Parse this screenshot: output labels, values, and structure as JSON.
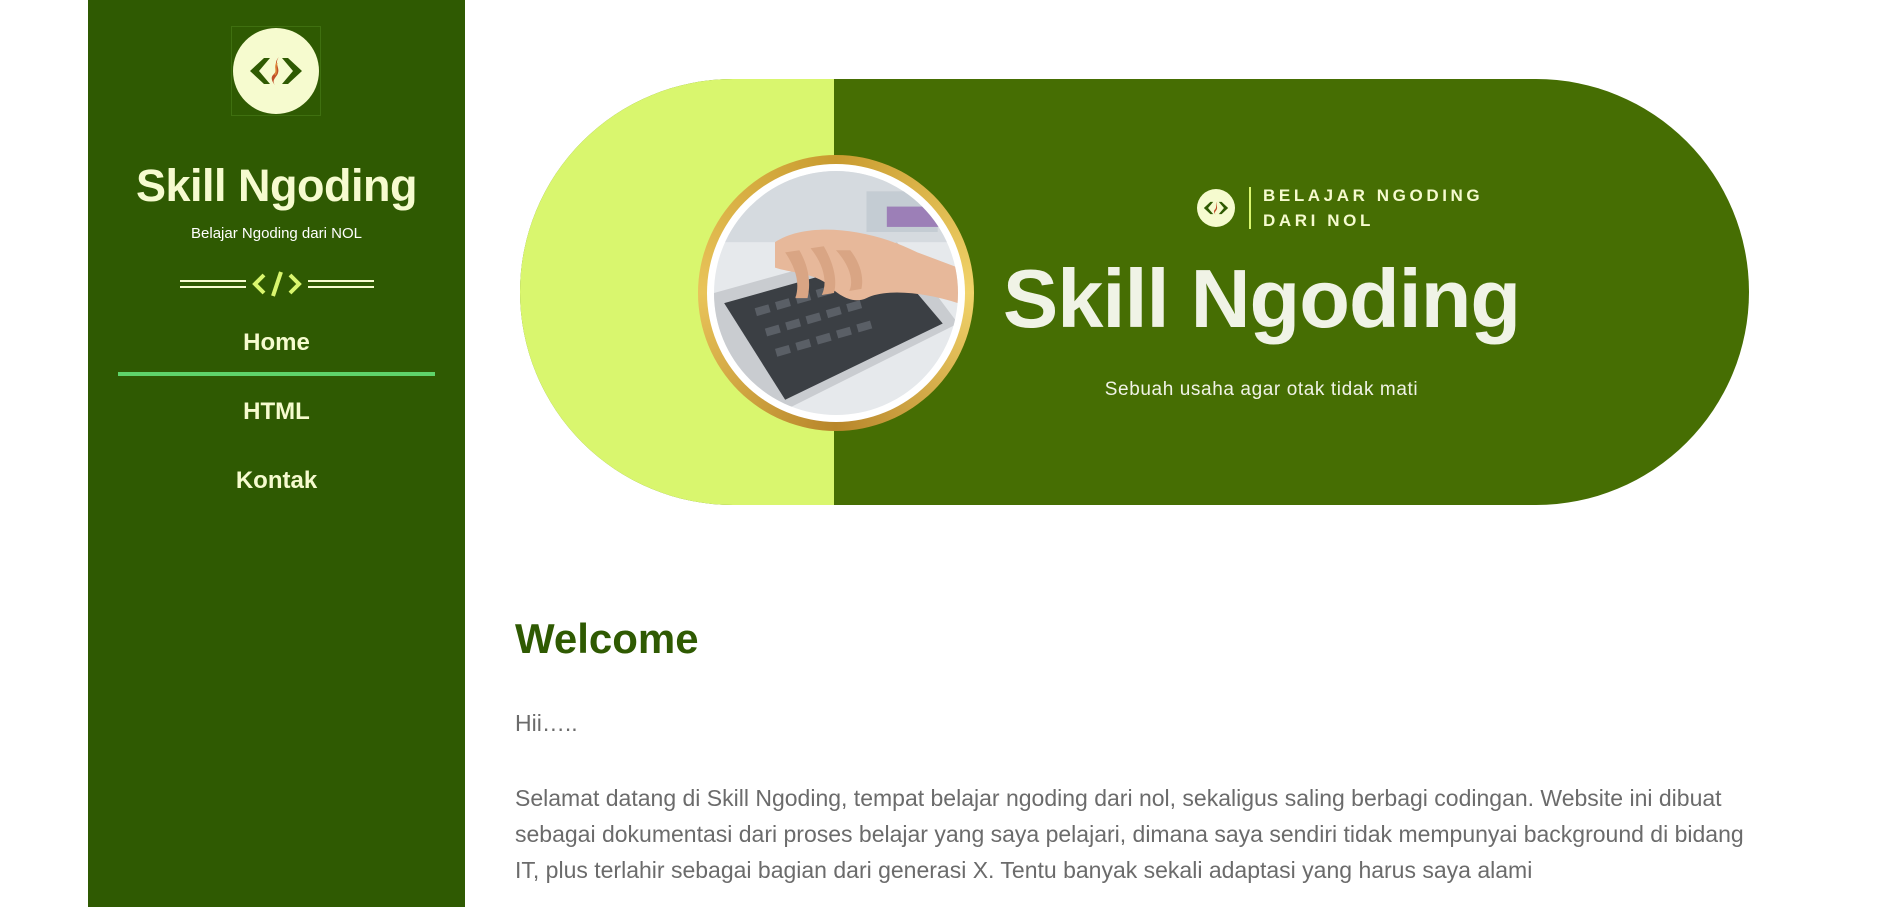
{
  "sidebar": {
    "logo_icon": "code-brackets-logo-icon",
    "title": "Skill Ngoding",
    "tagline": "Belajar Ngoding dari NOL",
    "divider_icon": "code-slash-icon",
    "nav": [
      {
        "label": "Home",
        "active": true
      },
      {
        "label": "HTML",
        "active": false
      },
      {
        "label": "Kontak",
        "active": false
      }
    ]
  },
  "hero": {
    "photo": "typing-on-laptop-photo",
    "badge_icon": "code-brackets-logo-icon",
    "badge_line1": "BELAJAR NGODING",
    "badge_line2": "DARI NOL",
    "title": "Skill Ngoding",
    "subtitle": "Sebuah usaha agar otak tidak mati"
  },
  "content": {
    "heading": "Welcome",
    "greeting": "Hii…..",
    "paragraph": "Selamat datang di Skill Ngoding, tempat belajar ngoding dari nol, sekaligus saling berbagi codingan. Website ini dibuat sebagai dokumentasi dari proses belajar yang saya pelajari, dimana saya sendiri tidak mempunyai background di bidang IT, plus terlahir sebagai bagian dari generasi X. Tentu banyak sekali adaptasi yang harus saya alami"
  },
  "colors": {
    "sidebar_bg": "#2f5a02",
    "hero_dark": "#466e03",
    "hero_light": "#d9f66e",
    "accent_cream": "#f6fbcf",
    "active_underline": "#5fd46a",
    "body_text": "#6b6b6b"
  }
}
